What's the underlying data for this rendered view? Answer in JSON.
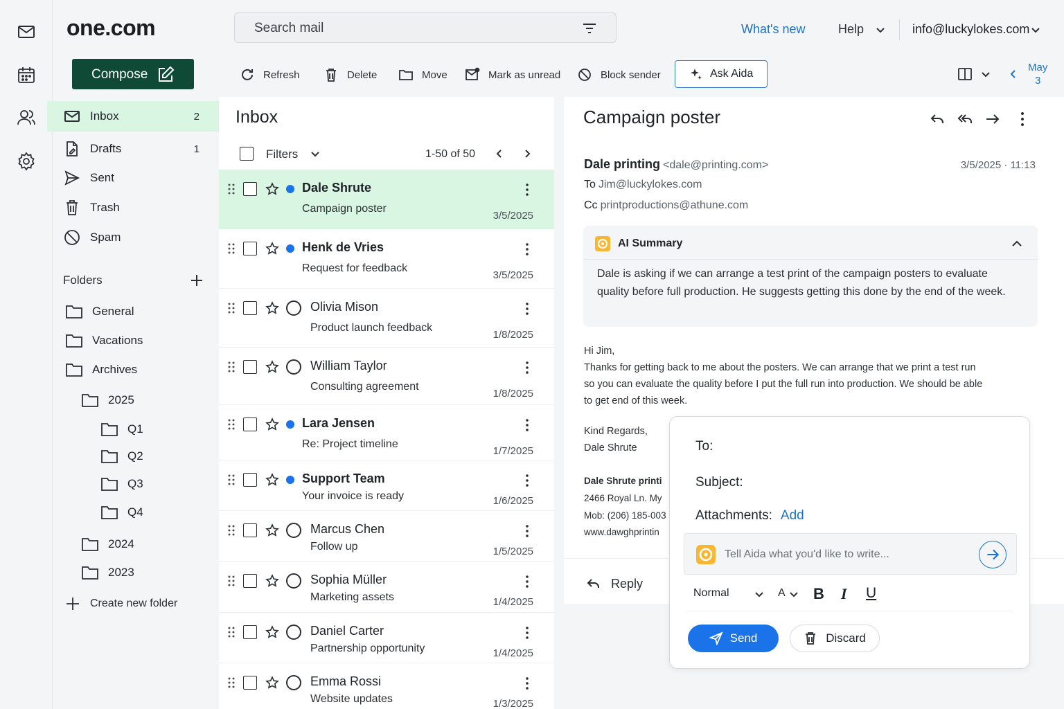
{
  "header": {
    "logo": "one.com",
    "search_placeholder": "Search mail",
    "whats_new": "What's new",
    "help": "Help",
    "account": "info@luckylokes.com"
  },
  "toolbar": {
    "compose": "Compose",
    "refresh": "Refresh",
    "delete": "Delete",
    "move": "Move",
    "mark_unread": "Mark as unread",
    "block_sender": "Block sender",
    "ask_aida": "Ask Aida",
    "date_month": "May",
    "date_day": "3"
  },
  "nav": [
    {
      "label": "Inbox",
      "count": "2"
    },
    {
      "label": "Drafts",
      "count": "1"
    },
    {
      "label": "Sent",
      "count": ""
    },
    {
      "label": "Trash",
      "count": ""
    },
    {
      "label": "Spam",
      "count": ""
    }
  ],
  "folders": {
    "title": "Folders",
    "items": [
      "General",
      "Vacations",
      "Archives",
      "2025",
      "Q1",
      "Q2",
      "Q3",
      "Q4",
      "2024",
      "2023"
    ],
    "create": "Create new folder"
  },
  "list": {
    "title": "Inbox",
    "filters": "Filters",
    "range": "1-50 of 50",
    "rows": [
      {
        "sender": "Dale Shrute",
        "subject": "Campaign poster",
        "date": "3/5/2025",
        "unread": true
      },
      {
        "sender": "Henk de Vries",
        "subject": "Request for feedback",
        "date": "3/5/2025",
        "unread": true
      },
      {
        "sender": "Olivia Mison",
        "subject": "Product launch feedback",
        "date": "1/8/2025",
        "unread": false
      },
      {
        "sender": "William Taylor",
        "subject": "Consulting agreement",
        "date": "1/8/2025",
        "unread": false
      },
      {
        "sender": "Lara Jensen",
        "subject": "Re: Project timeline",
        "date": "1/7/2025",
        "unread": true
      },
      {
        "sender": "Support Team",
        "subject": "Your invoice is ready",
        "date": "1/6/2025",
        "unread": true
      },
      {
        "sender": "Marcus Chen",
        "subject": "Follow up",
        "date": "1/5/2025",
        "unread": false
      },
      {
        "sender": "Sophia Müller",
        "subject": "Marketing assets",
        "date": "1/4/2025",
        "unread": false
      },
      {
        "sender": "Daniel Carter",
        "subject": "Partnership opportunity",
        "date": "1/4/2025",
        "unread": false
      },
      {
        "sender": "Emma Rossi",
        "subject": "Website updates",
        "date": "1/3/2025",
        "unread": false
      }
    ]
  },
  "message": {
    "title": "Campaign poster",
    "from_name": "Dale printing",
    "from_addr": "<dale@printing.com>",
    "datetime": "3/5/2025 · 11:13",
    "to_label": "To",
    "to": "Jim@luckylokes.com",
    "cc_label": "Cc",
    "cc": "printproductions@athune.com",
    "summary_title": "AI Summary",
    "summary": "Dale is asking if we can arrange a test print of the campaign posters to evaluate quality before full production. He suggests getting this done by the end of the week.",
    "greeting": "Hi Jim,",
    "body_1": "Thanks for getting back to me about the posters. We can arrange that we print a test run",
    "body_2": "so you can evaluate the quality before I put the full run into production. We should be able",
    "body_3": "to get end of this week.",
    "regards": "Kind Regards,",
    "signer": "Dale Shrute",
    "sig_company": "Dale Shrute printi",
    "sig_address": "2466 Royal Ln. My",
    "sig_mobile": "Mob: (206) 185-003",
    "sig_web": "www.dawghprintin",
    "reply": "Reply"
  },
  "compose_popup": {
    "to": "To:",
    "subject": "Subject:",
    "attachments": "Attachments:",
    "add": "Add",
    "aida_placeholder": "Tell Aida what you'd like to write...",
    "format": "Normal",
    "font": "A",
    "bold": "B",
    "italic": "I",
    "underline": "U",
    "send": "Send",
    "discard": "Discard"
  }
}
